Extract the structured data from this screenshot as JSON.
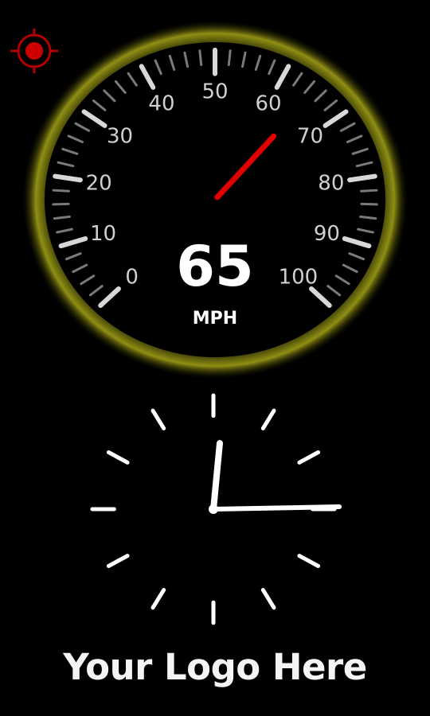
{
  "speedometer": {
    "speed": 65,
    "unit": "MPH",
    "scale_labels": [
      "0",
      "10",
      "20",
      "30",
      "40",
      "50",
      "60",
      "70",
      "80",
      "90",
      "100"
    ],
    "bezel_color": "#8c8c12",
    "needle_color": "#e00000"
  },
  "clock": {
    "hour_hand_position": 0,
    "minute_hand_position": 15
  },
  "gps_indicator": {
    "icon": "crosshair-target-icon",
    "color": "#c00000"
  },
  "logo": {
    "text": "Your Logo Here"
  }
}
